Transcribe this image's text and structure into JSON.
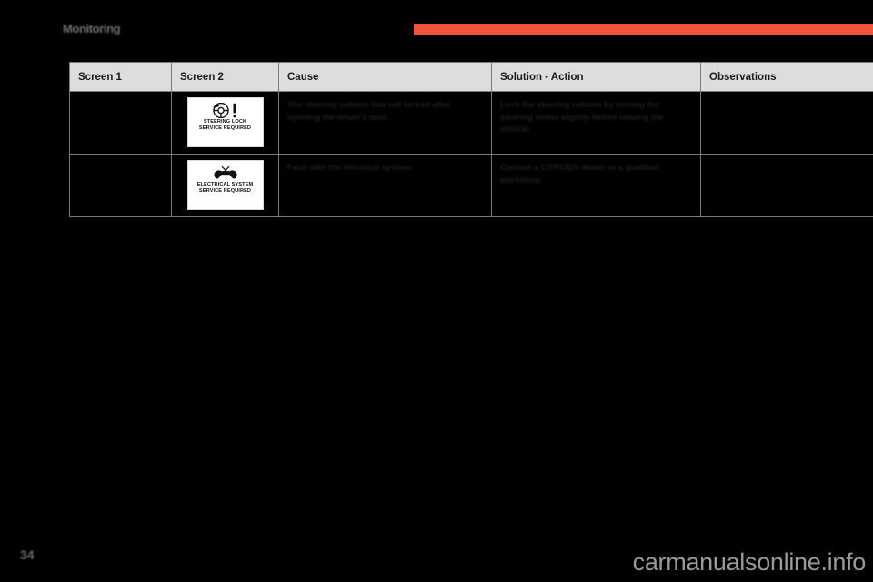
{
  "page": {
    "section_title": "Monitoring",
    "page_number": "34",
    "watermark": "carmanualsonline.info",
    "accent_color": "#F0543C",
    "background_color": "#000000",
    "header_fill": "#DDDDDD"
  },
  "table": {
    "columns": [
      {
        "label": "Screen 1",
        "key": "screen1"
      },
      {
        "label": "Screen 2",
        "key": "screen2"
      },
      {
        "label": "Cause",
        "key": "cause"
      },
      {
        "label": "Solution - Action",
        "key": "solution"
      },
      {
        "label": "Observations",
        "key": "observations"
      }
    ],
    "rows": [
      {
        "screen1": "",
        "screen2": {
          "icon": "steering-wheel-warning-icon",
          "label": "STEERING LOCK\nSERVICE REQUIRED"
        },
        "cause": "The steering column has not locked after opening the driver's door.",
        "solution": "Lock the steering column by turning the steering wheel slightly before leaving the vehicle.",
        "observations": ""
      },
      {
        "screen1": "",
        "screen2": {
          "icon": "electrical-system-warning-icon",
          "label": "ELECTRICAL SYSTEM\nSERVICE REQUIRED"
        },
        "cause": "Fault with the electrical system.",
        "solution": "Contact a CITROËN dealer or a qualified workshop.",
        "observations": ""
      }
    ]
  }
}
